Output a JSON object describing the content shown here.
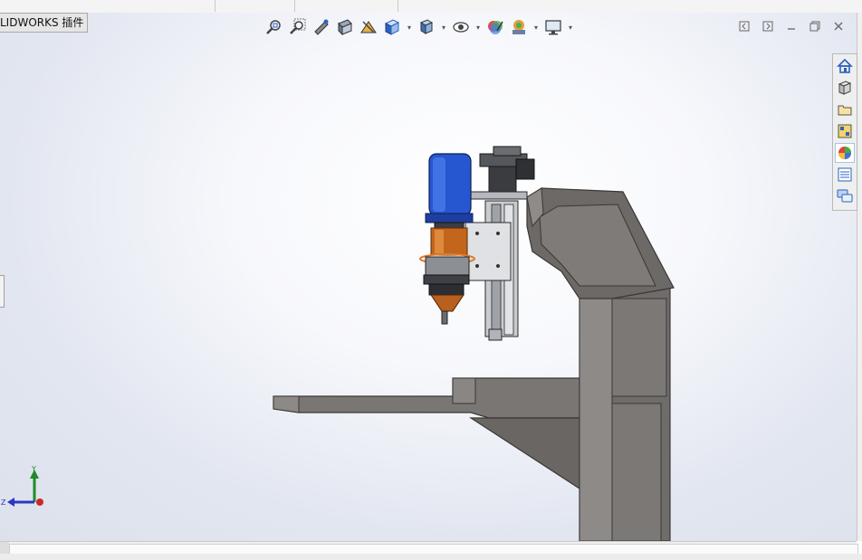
{
  "window": {
    "addins_tab_label": "LIDWORKS 插件"
  },
  "heads_up_toolbar": {
    "items": [
      {
        "icon": "zoom-to-fit-icon"
      },
      {
        "icon": "zoom-to-area-icon"
      },
      {
        "icon": "previous-view-icon"
      },
      {
        "icon": "section-view-icon"
      },
      {
        "icon": "dynamic-annotation-views-icon"
      },
      {
        "icon": "view-orientation-icon",
        "dropdown": true
      },
      {
        "icon": "display-style-icon",
        "dropdown": true
      },
      {
        "icon": "hide-show-items-icon",
        "dropdown": true
      },
      {
        "icon": "edit-appearance-icon"
      },
      {
        "icon": "apply-scene-icon",
        "dropdown": true
      },
      {
        "icon": "view-settings-icon",
        "dropdown": true
      }
    ]
  },
  "task_pane": {
    "items": [
      {
        "icon": "home-icon"
      },
      {
        "icon": "design-library-icon"
      },
      {
        "icon": "file-explorer-icon"
      },
      {
        "icon": "view-palette-icon"
      },
      {
        "icon": "appearances-scenes-icon",
        "active": true
      },
      {
        "icon": "custom-properties-icon"
      },
      {
        "icon": "forum-icon"
      }
    ]
  },
  "triad": {
    "y_label": "Y",
    "z_label": "Z"
  },
  "colors": {
    "frame_gray": "#6f6b68",
    "motor_blue": "#1f4fc4",
    "coupling_orange": "#c4651c",
    "rail_silver": "#c9cbcf"
  }
}
